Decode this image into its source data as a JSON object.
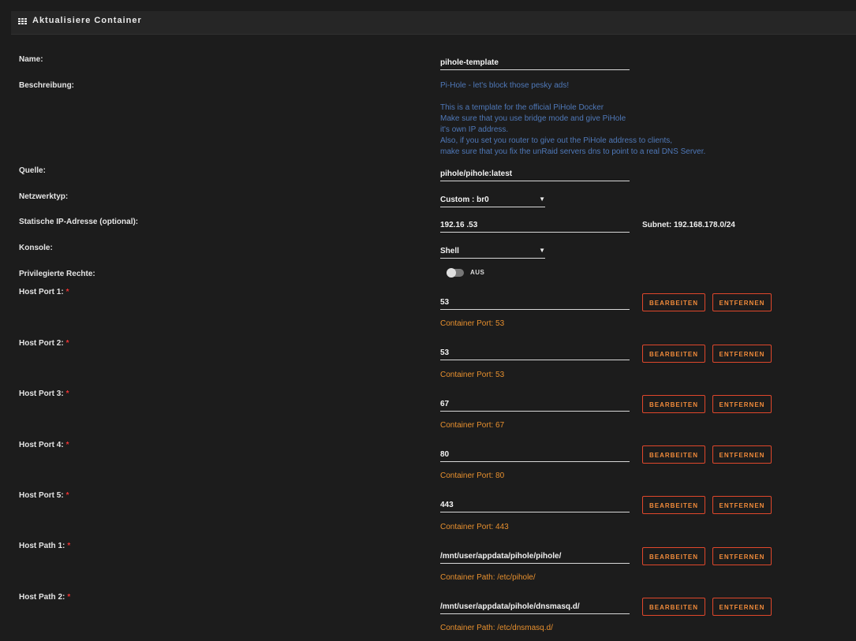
{
  "header": {
    "title": "Aktualisiere Container",
    "icon": "grid-icon"
  },
  "fields": {
    "name": {
      "label": "Name:",
      "value": "pihole-template"
    },
    "description": {
      "label": "Beschreibung:",
      "lines": [
        "Pi-Hole - let's block those pesky ads!",
        "",
        "This is a template for the official PiHole Docker",
        "Make sure that you use bridge mode and give PiHole",
        "it's own IP address.",
        "Also, if you set you router to give out the PiHole address to clients,",
        "make sure that you fix the unRaid servers dns to point to a real DNS Server."
      ]
    },
    "source": {
      "label": "Quelle:",
      "value": "pihole/pihole:latest"
    },
    "network": {
      "label": "Netzwerktyp:",
      "value": "Custom : br0"
    },
    "static_ip": {
      "label": "Statische IP-Adresse (optional):",
      "value": "192.16   .53",
      "subnet": "Subnet: 192.168.178.0/24"
    },
    "console": {
      "label": "Konsole:",
      "value": "Shell"
    },
    "privileged": {
      "label": "Privilegierte Rechte:",
      "state_label": "AUS",
      "enabled": false
    }
  },
  "buttons": {
    "edit": "BEARBEITEN",
    "remove": "ENTFERNEN"
  },
  "mappings": [
    {
      "label": "Host Port 1:",
      "value": "53",
      "note": "Container Port: 53"
    },
    {
      "label": "Host Port 2:",
      "value": "53",
      "note": "Container Port: 53"
    },
    {
      "label": "Host Port 3:",
      "value": "67",
      "note": "Container Port: 67"
    },
    {
      "label": "Host Port 4:",
      "value": "80",
      "note": "Container Port: 80"
    },
    {
      "label": "Host Port 5:",
      "value": "443",
      "note": "Container Port: 443"
    },
    {
      "label": "Host Path 1:",
      "value": "/mnt/user/appdata/pihole/pihole/",
      "note": "Container Path: /etc/pihole/"
    },
    {
      "label": "Host Path 2:",
      "value": "/mnt/user/appdata/pihole/dnsmasq.d/",
      "note": "Container Path: /etc/dnsmasq.d/"
    }
  ],
  "colors": {
    "accent": "#e0472b",
    "note": "#e8902e",
    "description": "#4f78b8",
    "background": "#1c1c1c"
  }
}
